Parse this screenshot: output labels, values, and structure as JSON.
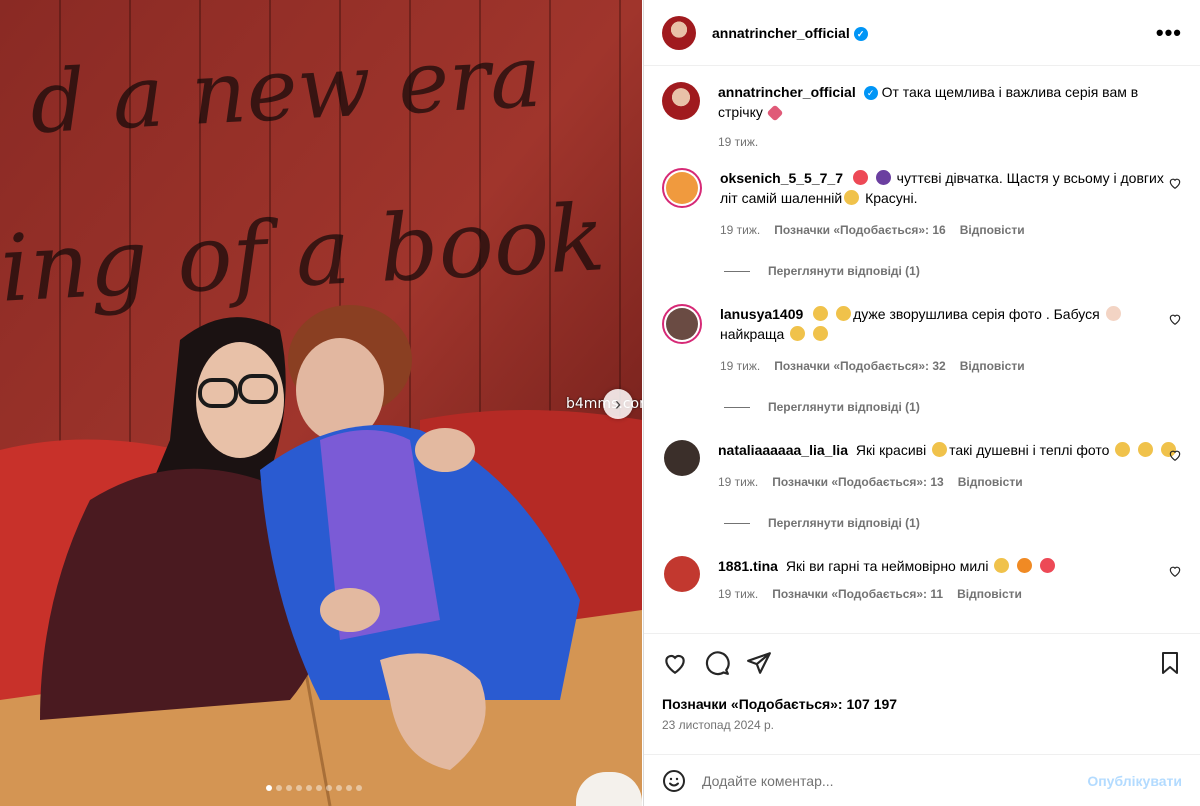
{
  "photo": {
    "wall_text_line1": "d a new era",
    "wall_text_line2": "ing of a book",
    "watermark": "b4mms.com",
    "carousel_dot_count": 10,
    "carousel_active_index": 0
  },
  "post": {
    "author": "annatrincher_official",
    "more_label": "•••"
  },
  "caption": {
    "username": "annatrincher_official",
    "text": "От така щемлива і важлива серія вам в стрічку",
    "time": "19 тиж."
  },
  "comments": [
    {
      "username": "oksenich_5_5_7_7",
      "text_a": "чуттєві дівчатка. Щастя у всьому і довгих літ самій шаленній",
      "text_b": "Красуні.",
      "time": "19 тиж.",
      "likes": "Позначки «Подобається»: 16",
      "reply": "Відповісти",
      "view_replies": "Переглянути відповіді (1)"
    },
    {
      "username": "lanusya1409",
      "text_a": "дуже зворушлива серія фото . Бабуся",
      "text_b": "найкраща",
      "time": "19 тиж.",
      "likes": "Позначки «Подобається»: 32",
      "reply": "Відповісти",
      "view_replies": "Переглянути відповіді (1)"
    },
    {
      "username": "nataliaaaaaa_lia_lia",
      "text_a": "Які красиві",
      "text_b": "такі душевні і теплі фото",
      "time": "19 тиж.",
      "likes": "Позначки «Подобається»: 13",
      "reply": "Відповісти",
      "view_replies": "Переглянути відповіді (1)"
    },
    {
      "username": "1881.tina",
      "text_a": "Які ви гарні та неймовірно милі",
      "time": "19 тиж.",
      "likes": "Позначки «Подобається»: 11",
      "reply": "Відповісти"
    }
  ],
  "actions": {
    "likes_count": "Позначки «Подобається»: 107 197",
    "date": "23 листопад 2024 р."
  },
  "comment_box": {
    "placeholder": "Додайте коментар...",
    "publish_label": "Опублікувати"
  },
  "colors": {
    "verified": "#0095f6",
    "heart": "#ed4956",
    "muted": "#737373",
    "publish_disabled": "#b3dbff"
  }
}
